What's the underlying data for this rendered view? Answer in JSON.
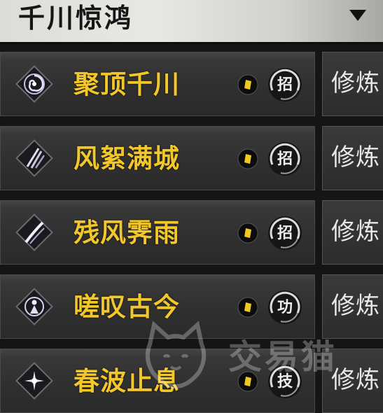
{
  "header": {
    "title": "千川惊鸿",
    "dropdown_icon": "chevron-down-icon"
  },
  "skills": [
    {
      "name": "聚顶千川",
      "type": "招",
      "button": "修炼",
      "icon": "vortex-skill-icon"
    },
    {
      "name": "风絮满城",
      "type": "招",
      "button": "修炼",
      "icon": "claw-slash-skill-icon"
    },
    {
      "name": "残风霁雨",
      "type": "招",
      "button": "修炼",
      "icon": "blade-slash-skill-icon"
    },
    {
      "name": "嗟叹古今",
      "type": "功",
      "button": "修炼",
      "icon": "figure-aura-skill-icon"
    },
    {
      "name": "春波止息",
      "type": "技",
      "button": "修炼",
      "icon": "burst-skill-icon"
    }
  ],
  "watermark": {
    "text": "交易猫"
  },
  "colors": {
    "skill_name": "#f2c72c",
    "card_bg": "#333333",
    "header_bg": "#e2e2de"
  }
}
